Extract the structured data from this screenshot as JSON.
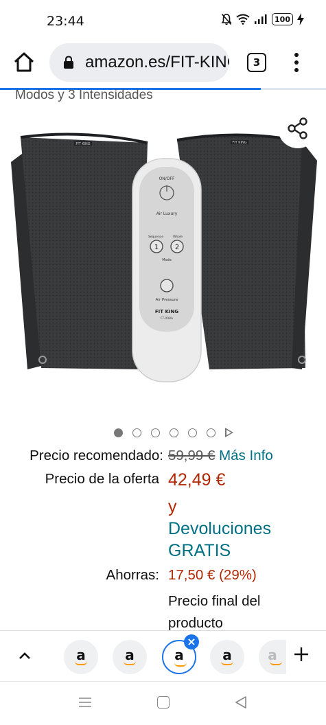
{
  "status_bar": {
    "time": "23:44",
    "battery": "100",
    "icons": [
      "mute-icon",
      "wifi-icon",
      "signal-icon",
      "battery-icon",
      "charging-icon"
    ]
  },
  "browser": {
    "url": "amazon.es/FIT-KING",
    "tab_count": "3",
    "load_progress": 0.8
  },
  "page": {
    "subtitle": "Modos y 3 Intensidades",
    "carousel": {
      "count": 6,
      "active_index": 0
    },
    "product_image": {
      "brand_label": "FIT KING",
      "remote_labels": {
        "power": "ON/OFF",
        "mode_name": "Air Luxury",
        "sequence": "Sequence",
        "whole": "Whole",
        "mode": "Mode",
        "pressure": "Air Pressure",
        "brand": "FIT KING",
        "model": "FT-008A",
        "btn1": "1",
        "btn2": "2"
      }
    },
    "pricing": {
      "list_label": "Precio recomendado:",
      "list_price": "59,99 €",
      "more_info": "Más Info",
      "deal_label": "Precio de la oferta",
      "deal_price": "42,49 €",
      "and": "y",
      "free_returns_1": "Devoluciones",
      "free_returns_2": "GRATIS",
      "savings_label": "Ahorras:",
      "savings_value": "17,50 € (29%)",
      "final_1": "Precio final del",
      "final_2": "producto"
    }
  },
  "tab_strip": {
    "tabs": [
      "a",
      "a",
      "a",
      "a",
      "a"
    ],
    "active_index": 2
  },
  "colors": {
    "accent": "#1a73e8",
    "price_red": "#b12704",
    "link_teal": "#007185",
    "amazon_orange": "#ff9900"
  }
}
